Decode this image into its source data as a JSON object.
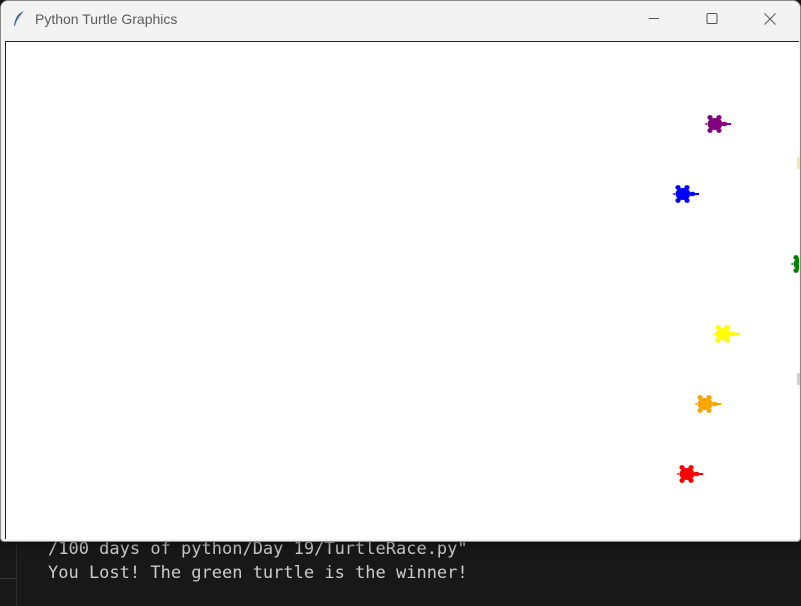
{
  "window": {
    "title": "Python Turtle Graphics",
    "icon": "feather-icon",
    "controls": [
      "minimize-icon",
      "maximize-icon",
      "close-icon"
    ]
  },
  "terminal": {
    "lines": [
      "/100 days of python/Day 19/TurtleRace.py\"",
      "You Lost! The green turtle is the winner!"
    ]
  },
  "turtles": [
    {
      "color": "#800080",
      "name": "purple"
    },
    {
      "color": "#0000ff",
      "name": "blue"
    },
    {
      "color": "#008000",
      "name": "green"
    },
    {
      "color": "#ffff00",
      "name": "yellow"
    },
    {
      "color": "#ffa500",
      "name": "orange"
    },
    {
      "color": "#ff0000",
      "name": "red"
    }
  ],
  "colors": {
    "titlebar": "#f3f3f3",
    "canvas": "#ffffff",
    "terminal_bg": "#181818",
    "terminal_text": "#cccccc"
  }
}
